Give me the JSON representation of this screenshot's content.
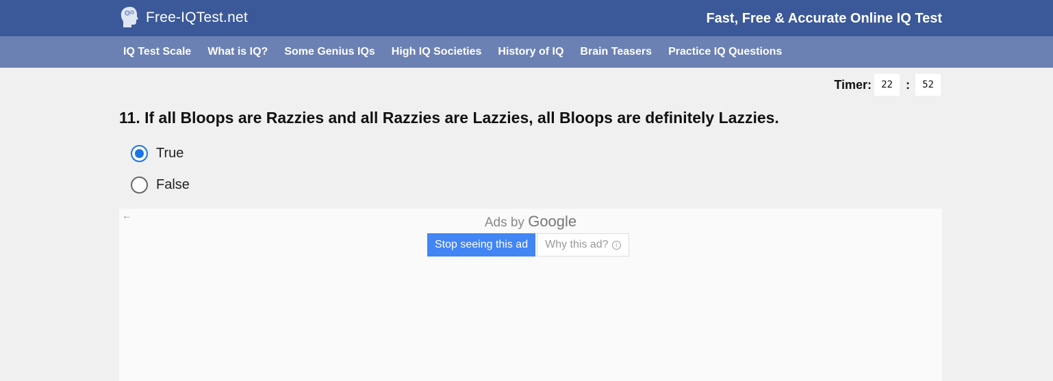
{
  "header": {
    "logo_text": "Free-IQTest.net",
    "tagline": "Fast, Free & Accurate Online IQ Test",
    "brand_color": "#3b5998",
    "nav_color": "#6b80b3"
  },
  "nav": {
    "items": [
      {
        "label": "IQ Test Scale"
      },
      {
        "label": "What is IQ?"
      },
      {
        "label": "Some Genius IQs"
      },
      {
        "label": "High IQ Societies"
      },
      {
        "label": "History of IQ"
      },
      {
        "label": "Brain Teasers"
      },
      {
        "label": "Practice IQ Questions"
      }
    ]
  },
  "timer": {
    "label": "Timer:",
    "minutes": "22",
    "separator": ":",
    "seconds": "52"
  },
  "question": {
    "text": "11. If all Bloops are Razzies and all Razzies are Lazzies, all Bloops are definitely Lazzies.",
    "options": [
      {
        "label": "True",
        "selected": true
      },
      {
        "label": "False",
        "selected": false
      }
    ]
  },
  "ad": {
    "back_arrow": "←",
    "ads_by": "Ads by",
    "google": "Google",
    "stop_label": "Stop seeing this ad",
    "why_label": "Why this ad?",
    "info_symbol": "i"
  }
}
